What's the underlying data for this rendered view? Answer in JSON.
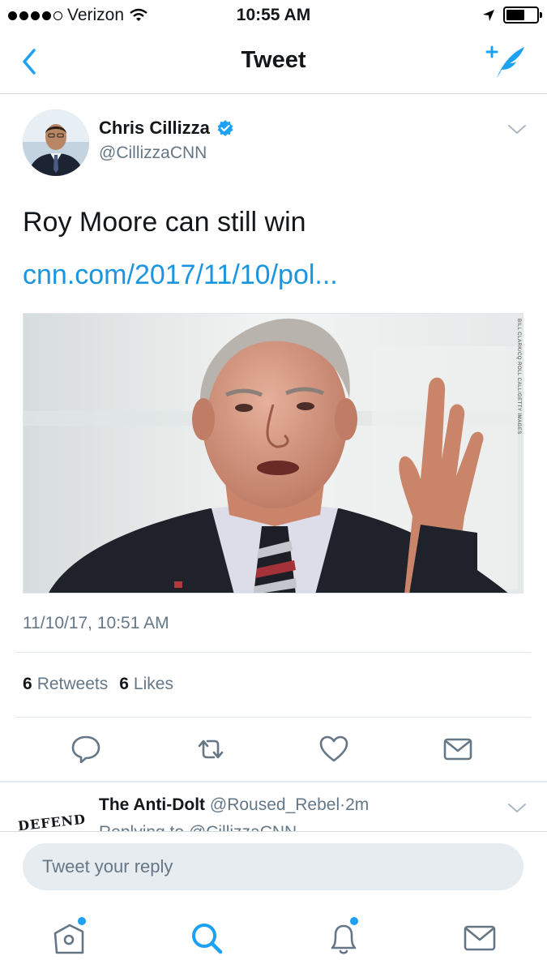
{
  "status_bar": {
    "carrier": "Verizon",
    "time": "10:55 AM",
    "signal_bars_filled": 4,
    "signal_bars_total": 5,
    "battery_level": 0.5
  },
  "nav": {
    "title": "Tweet",
    "back_icon": "chevron-left-icon",
    "compose_icon": "compose-tweet-icon"
  },
  "tweet": {
    "author_name": "Chris Cillizza",
    "author_handle": "@CillizzaCNN",
    "verified": true,
    "text": "Roy Moore can still win",
    "link": "cnn.com/2017/11/10/pol...",
    "photo_credit": "BILL CLARK/CQ ROLL CALL/GETTY IMAGES",
    "timestamp": "11/10/17, 10:51 AM",
    "retweets_count": "6",
    "retweets_label": "Retweets",
    "likes_count": "6",
    "likes_label": "Likes"
  },
  "reply_preview": {
    "name": "The Anti-Dolt",
    "handle": "@Roused_Rebel",
    "separator": "·",
    "age": "2m",
    "sub": "Replying to @CillizzaCNN",
    "avatar_text": "DEFEND"
  },
  "composer": {
    "placeholder": "Tweet your reply"
  },
  "tabbar": {
    "items": [
      "home-icon",
      "search-icon",
      "notifications-icon",
      "messages-icon"
    ],
    "active": "search-icon"
  },
  "colors": {
    "accent": "#1da1f2",
    "link": "#1b95e0",
    "muted": "#657786"
  }
}
